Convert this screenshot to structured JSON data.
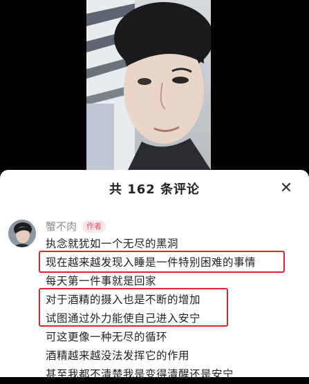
{
  "comments_panel": {
    "title": "共 162 条评论",
    "close_glyph": "✕"
  },
  "comment": {
    "username": "蟹不肉",
    "author_badge": "作者",
    "lines": [
      "执念就犹如一个无尽的黑洞",
      "现在越来越发现入睡是一件特别困难的事情",
      "每天第一件事就是回家",
      "对于酒精的摄入也是不断的增加",
      "试图通过外力能使自己进入安宁",
      "可这更像一种无尽的循环",
      "酒精越来越没法发挥它的作用",
      "甚至我都不清楚我是变得清醒还是安宁"
    ]
  },
  "colors": {
    "highlight_border": "#e0242c",
    "badge_text": "#e84d5f",
    "badge_bg": "#fde7ea"
  }
}
